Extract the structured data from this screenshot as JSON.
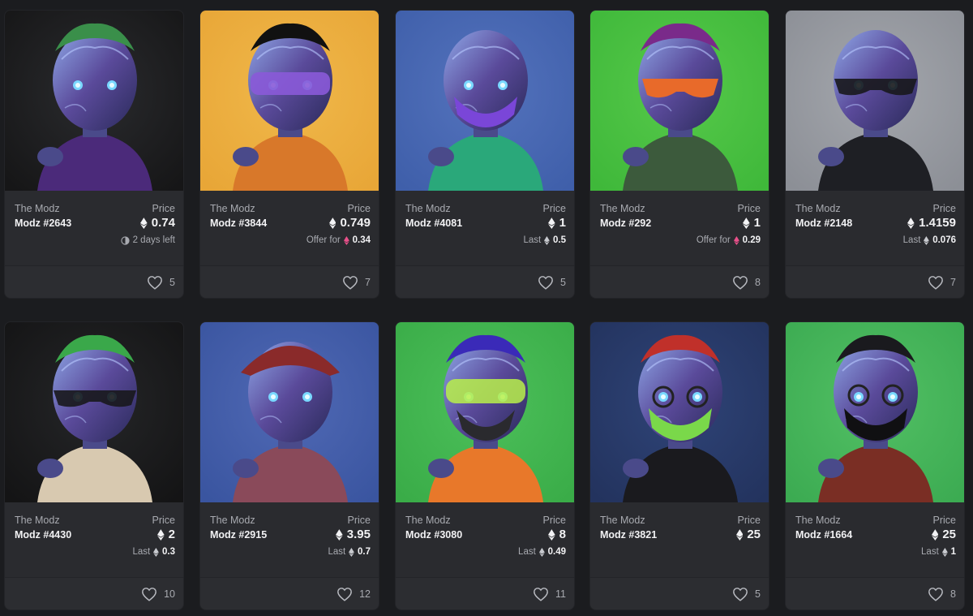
{
  "cards": [
    {
      "collection": "The Modz",
      "name": "Modz #2643",
      "price_label": "Price",
      "price": "0.74",
      "sub_type": "time",
      "sub_text": "2 days left",
      "likes": "5",
      "bg": "#161617",
      "bg2": "#2a2b2e",
      "hair": "#3a8f4a",
      "top": "#4b2a7a",
      "accessory": "none"
    },
    {
      "collection": "The Modz",
      "name": "Modz #3844",
      "price_label": "Price",
      "price": "0.749",
      "sub_type": "offer",
      "sub_text": "Offer for",
      "sub_value": "0.34",
      "likes": "7",
      "bg": "#e8a637",
      "bg2": "#f0b84a",
      "hair": "#111111",
      "top": "#d8782a",
      "accessory": "visor"
    },
    {
      "collection": "The Modz",
      "name": "Modz #4081",
      "price_label": "Price",
      "price": "1",
      "sub_type": "last",
      "sub_text": "Last",
      "sub_value": "0.5",
      "likes": "5",
      "bg": "#3f5faa",
      "bg2": "#5473bd",
      "hair": "none",
      "top": "#2aa87a",
      "accessory": "mask-purple"
    },
    {
      "collection": "The Modz",
      "name": "Modz #292",
      "price_label": "Price",
      "price": "1",
      "sub_type": "offer",
      "sub_text": "Offer for",
      "sub_value": "0.29",
      "likes": "8",
      "bg": "#3fb83a",
      "bg2": "#56c94a",
      "hair": "#7a2a8a",
      "top": "#3c5a3c",
      "accessory": "glasses-orange"
    },
    {
      "collection": "The Modz",
      "name": "Modz #2148",
      "price_label": "Price",
      "price": "1.4159",
      "sub_type": "last",
      "sub_text": "Last",
      "sub_value": "0.076",
      "likes": "7",
      "bg": "#8c8f96",
      "bg2": "#a4a7ad",
      "hair": "none",
      "top": "#1e1f24",
      "accessory": "glasses-dark"
    },
    {
      "collection": "The Modz",
      "name": "Modz #4430",
      "price_label": "Price",
      "price": "2",
      "sub_type": "last",
      "sub_text": "Last",
      "sub_value": "0.3",
      "likes": "10",
      "bg": "#141415",
      "bg2": "#252628",
      "hair": "#3aa84a",
      "top": "#d8c9b0",
      "accessory": "glasses-dark"
    },
    {
      "collection": "The Modz",
      "name": "Modz #2915",
      "price_label": "Price",
      "price": "3.95",
      "sub_type": "last",
      "sub_text": "Last",
      "sub_value": "0.7",
      "likes": "12",
      "bg": "#3a55a0",
      "bg2": "#5069b5",
      "hair": "#8a2a2a",
      "top": "#8a4a5a",
      "accessory": "hat"
    },
    {
      "collection": "The Modz",
      "name": "Modz #3080",
      "price_label": "Price",
      "price": "8",
      "sub_type": "last",
      "sub_text": "Last",
      "sub_value": "0.49",
      "likes": "11",
      "bg": "#3aac48",
      "bg2": "#4cc05a",
      "hair": "#3a2ab8",
      "top": "#e8782a",
      "accessory": "visor-green"
    },
    {
      "collection": "The Modz",
      "name": "Modz #3821",
      "price_label": "Price",
      "price": "25",
      "sub_type": "none",
      "likes": "5",
      "bg": "#23335e",
      "bg2": "#2f4478",
      "hair": "#c0302a",
      "top": "#1a1a1e",
      "accessory": "mask-green"
    },
    {
      "collection": "The Modz",
      "name": "Modz #1664",
      "price_label": "Price",
      "price": "25",
      "sub_type": "last",
      "sub_text": "Last",
      "sub_value": "1",
      "likes": "8",
      "bg": "#3cab52",
      "bg2": "#52c064",
      "hair": "#1a1a1e",
      "top": "#7a2e24",
      "accessory": "mask-black"
    }
  ]
}
